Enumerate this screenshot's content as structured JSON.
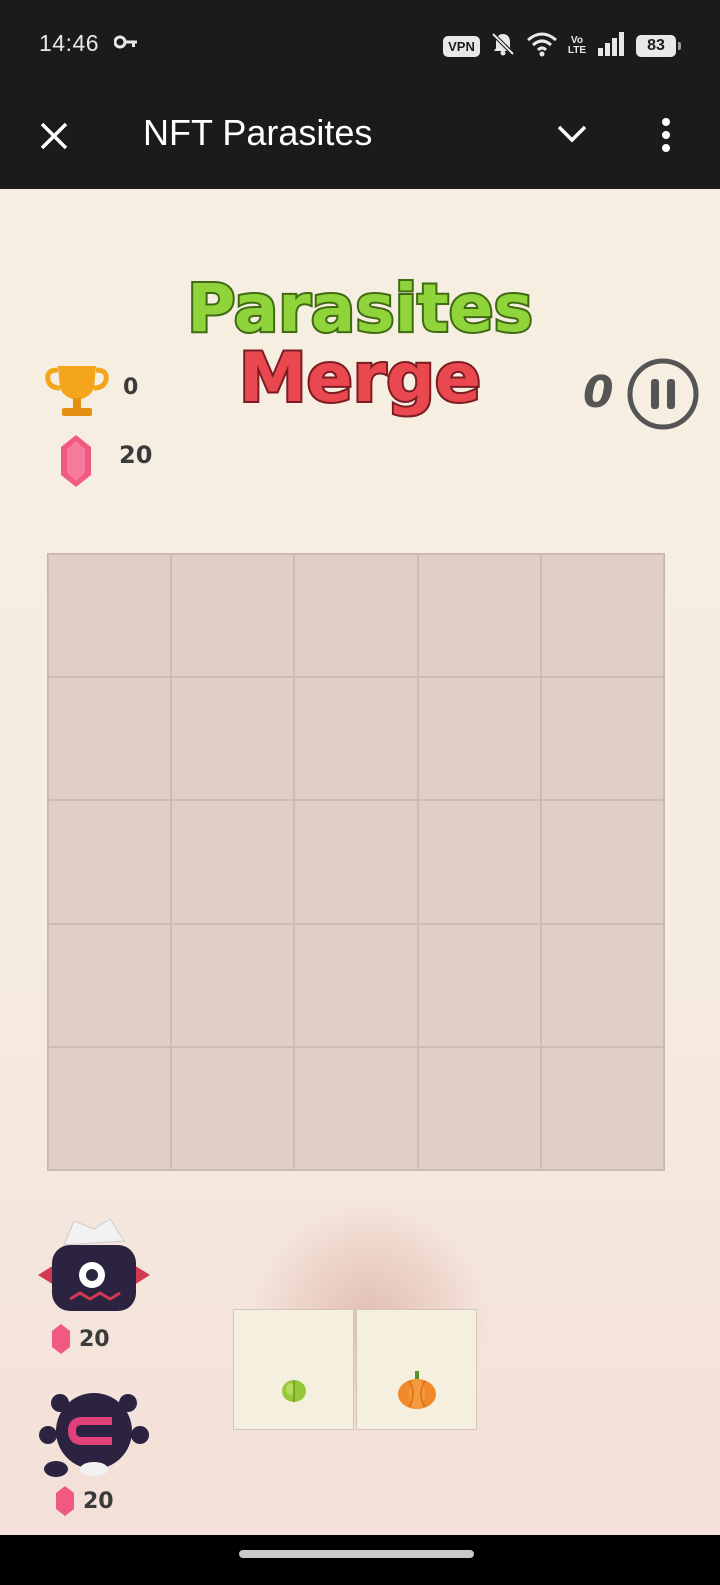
{
  "status_bar": {
    "time": "14:46",
    "vpn": "VPN",
    "volte_top": "Vo",
    "volte_bottom": "LTE",
    "battery": "83"
  },
  "app_bar": {
    "title": "NFT Parasites",
    "close_icon": "close-icon",
    "chevron_icon": "chevron-down-icon",
    "more_icon": "more-vert-icon"
  },
  "game": {
    "logo_line1": "Parasites",
    "logo_line2": "Merge",
    "trophy_count": "0",
    "gems": "20",
    "score": "0",
    "grid": {
      "rows": 5,
      "cols": 5
    },
    "creatures": [
      {
        "name": "white-haired-parasite",
        "cost": "20"
      },
      {
        "name": "magnet-parasite",
        "cost": "20"
      }
    ],
    "queue_slots": [
      {
        "item": "green-seed"
      },
      {
        "item": "orange-pumpkin"
      }
    ]
  },
  "colors": {
    "logo_green": "#8fd43a",
    "logo_red": "#e8484e",
    "gem_pink": "#f05a82",
    "trophy_gold": "#f4a51c",
    "grid_bg": "#ddcdc5"
  }
}
